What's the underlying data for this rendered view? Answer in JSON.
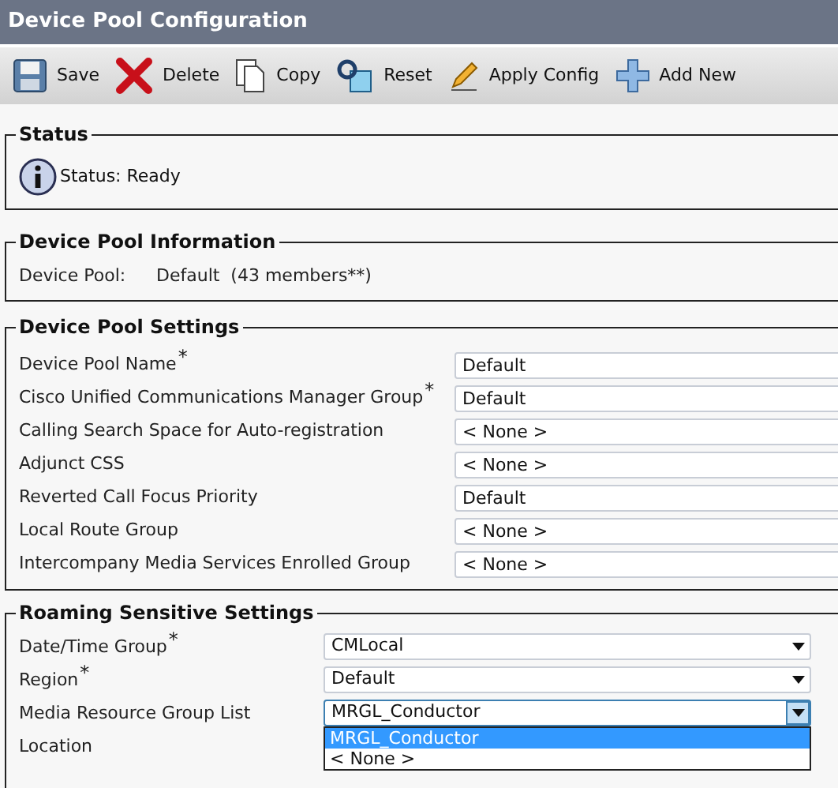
{
  "window": {
    "title": "Device Pool Configuration"
  },
  "toolbar": [
    {
      "label": "Save",
      "kind": "save"
    },
    {
      "label": "Delete",
      "kind": "delete"
    },
    {
      "label": "Copy",
      "kind": "copy"
    },
    {
      "label": "Reset",
      "kind": "reset"
    },
    {
      "label": "Apply Config",
      "kind": "apply"
    },
    {
      "label": "Add New",
      "kind": "add"
    }
  ],
  "status": {
    "legend": "Status",
    "text": "Status: Ready"
  },
  "info": {
    "legend": "Device Pool Information",
    "label": "Device Pool:",
    "value": "Default  (43 members**)"
  },
  "settings": {
    "legend": "Device Pool Settings",
    "rows": [
      {
        "label": "Device Pool Name",
        "required_mark": "*",
        "value": "Default"
      },
      {
        "label": "Cisco Unified Communications Manager Group",
        "required_mark": "*",
        "value": "Default"
      },
      {
        "label": "Calling Search Space for Auto-registration",
        "value": "< None >"
      },
      {
        "label": "Adjunct CSS",
        "value": "< None >"
      },
      {
        "label": "Reverted Call Focus Priority",
        "value": "Default"
      },
      {
        "label": "Local Route Group",
        "value": "< None >"
      },
      {
        "label": "Intercompany Media Services Enrolled Group",
        "value": "< None >"
      }
    ]
  },
  "roaming": {
    "legend": "Roaming Sensitive Settings",
    "rows": [
      {
        "label": "Date/Time Group",
        "required_mark": "*",
        "value": "CMLocal",
        "expanded": false
      },
      {
        "label": "Region",
        "required_mark": "*",
        "value": "Default",
        "expanded": false
      },
      {
        "label": "Media Resource Group List",
        "value": "MRGL_Conductor",
        "expanded": true,
        "options": [
          {
            "label": "MRGL_Conductor",
            "selected": true
          },
          {
            "label": "< None >",
            "selected": false
          }
        ]
      },
      {
        "label": "Location"
      }
    ]
  }
}
